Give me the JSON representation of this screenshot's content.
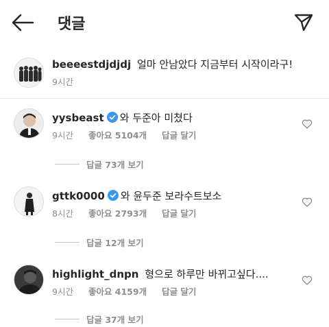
{
  "header": {
    "title": "댓글",
    "back_icon": "arrow-left-icon",
    "send_icon": "paper-plane-icon"
  },
  "caption": {
    "username": "beeeestdjdjdj",
    "text": "얼마 안남았다 지금부터 시작이라구!",
    "time": "9시간"
  },
  "comments": [
    {
      "username": "yysbeast",
      "verified": true,
      "text": "와 두준아 미쳤다",
      "time": "9시간",
      "likes": "좋아요 5104개",
      "reply_label": "답글 달기",
      "view_replies": "답글 73개 보기"
    },
    {
      "username": "gttk0000",
      "verified": true,
      "text": "와 윤두준 보라수트보소",
      "time": "8시간",
      "likes": "좋아요 2793개",
      "reply_label": "답글 달기",
      "view_replies": "답글 12개 보기"
    },
    {
      "username": "highlight_dnpn",
      "verified": false,
      "text": "형으로 하루만 바뀌고싶다....",
      "time": "9시간",
      "likes": "좋아요 4159개",
      "reply_label": "답글 달기",
      "view_replies": "답글 37개 보기"
    }
  ],
  "colors": {
    "text": "#262626",
    "secondary": "#8e8e8e",
    "verified": "#3897f0"
  }
}
